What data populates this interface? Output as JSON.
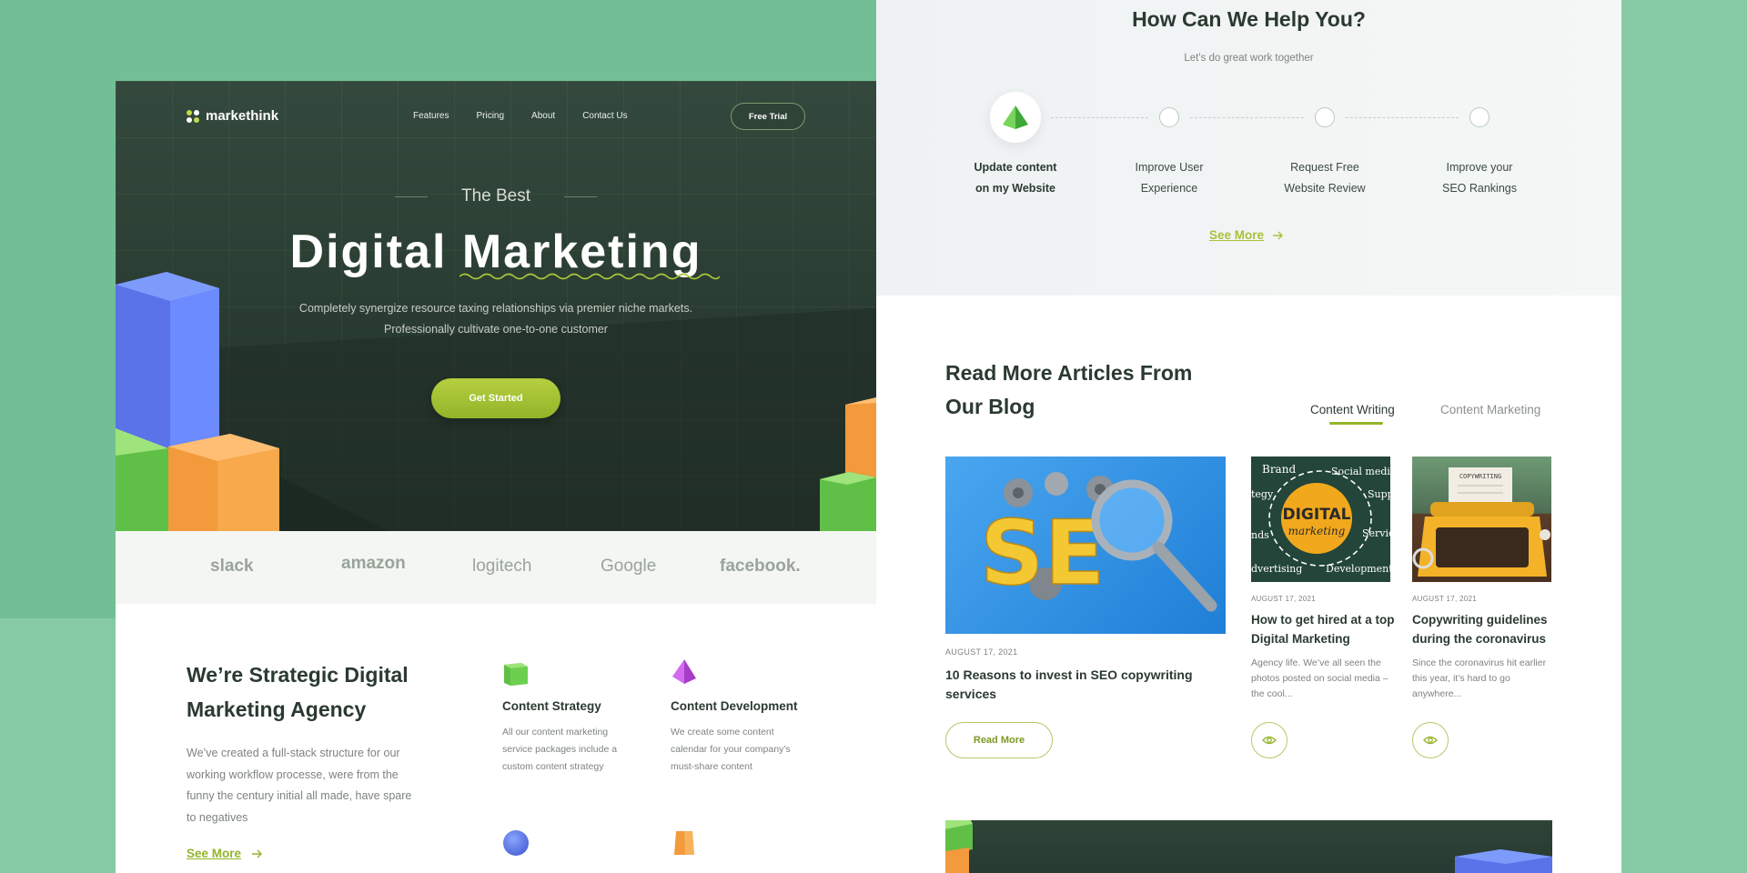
{
  "left_page": {
    "brand_name": "markethink",
    "nav": [
      "Features",
      "Pricing",
      "About",
      "Contact Us"
    ],
    "free_trial": "Free Trial",
    "hero": {
      "eyebrow": "The Best",
      "title": "Digital Marketing",
      "description": "Completely synergize resource taxing relationships via premier niche markets. Professionally cultivate one-to-one customer",
      "cta": "Get Started"
    },
    "brands": [
      "slack",
      "amazon",
      "logitech",
      "Google",
      "facebook."
    ],
    "agency": {
      "title": "We’re Strategic Digital Marketing Agency",
      "description": "We’ve created a full-stack structure for our working workflow processe, were from the funny the century initial all made, have spare to negatives",
      "see_more": "See More"
    },
    "services": [
      {
        "title": "Content Strategy",
        "description": "All our content marketing service packages include a custom content strategy",
        "icon": "green-cube-icon"
      },
      {
        "title": "Content Development",
        "description": "We create some content calendar for your company’s must-share content",
        "icon": "purple-pyramid-icon"
      },
      {
        "icon": "blue-sphere-icon"
      },
      {
        "icon": "orange-cylinder-icon"
      }
    ]
  },
  "right_page": {
    "help": {
      "title": "How Can We Help You?",
      "subtitle": "Let's do great work together",
      "steps": [
        {
          "line1": "Update content",
          "line2": "on my Website",
          "active": true
        },
        {
          "line1": "Improve User",
          "line2": "Experience",
          "active": false
        },
        {
          "line1": "Request Free",
          "line2": "Website Review",
          "active": false
        },
        {
          "line1": "Improve your",
          "line2": "SEO Rankings",
          "active": false
        }
      ],
      "see_more": "See More"
    },
    "blog": {
      "title": "Read More Articles From Our Blog",
      "tabs": [
        {
          "label": "Content Writing",
          "active": true
        },
        {
          "label": "Content Marketing",
          "active": false
        }
      ],
      "posts": [
        {
          "date": "AUGUST 17, 2021",
          "title": "10 Reasons to invest in SEO copywriting services",
          "cta": "Read More",
          "image_text": "SE"
        },
        {
          "date": "AUGUST 17, 2021",
          "title": "How to get hired at a top Digital Marketing",
          "excerpt": "Agency life. We’ve all seen the photos posted on social media – the cool...",
          "image_words": [
            "DIGITAL",
            "marketing",
            "Brand",
            "Social media",
            "tegy",
            "Suppo",
            "nds",
            "Servic",
            "dvertising",
            "Development"
          ]
        },
        {
          "date": "AUGUST 17, 2021",
          "title": "Copywriting guidelines during the coronavirus",
          "excerpt": "Since the coronavirus hit earlier this year, it’s hard to go anywhere...",
          "image_text": "COPYWRITING"
        }
      ]
    }
  },
  "colors": {
    "accent": "#93b42a",
    "dark": "#2b3a31",
    "background": "#72bf95"
  }
}
